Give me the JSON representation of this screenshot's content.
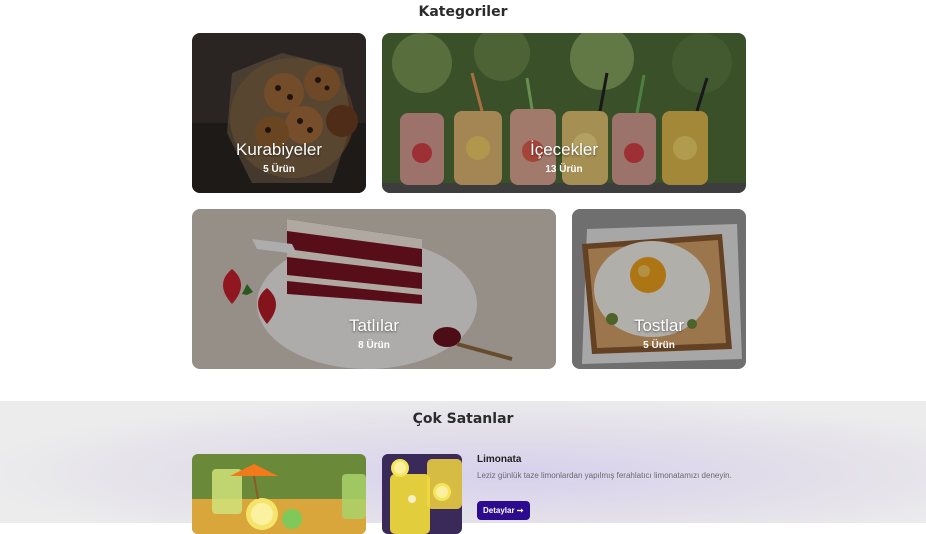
{
  "categories_section": {
    "title": "Kategoriler",
    "cards": [
      {
        "name": "Kurabiyeler",
        "count": "5 Ürün"
      },
      {
        "name": "İçecekler",
        "count": "13 Ürün"
      },
      {
        "name": "Tatlılar",
        "count": "8 Ürün"
      },
      {
        "name": "Tostlar",
        "count": "5 Ürün"
      }
    ]
  },
  "bestsellers_section": {
    "title": "Çok Satanlar",
    "product": {
      "name": "Limonata",
      "description": "Leziz günlük taze limonlardan yapılmış ferahlatıcı limonatamızı deneyin.",
      "button_label": "Detaylar ➞"
    }
  },
  "colors": {
    "accent": "#2d0b8f",
    "best_bg": "#e3e0ea"
  }
}
